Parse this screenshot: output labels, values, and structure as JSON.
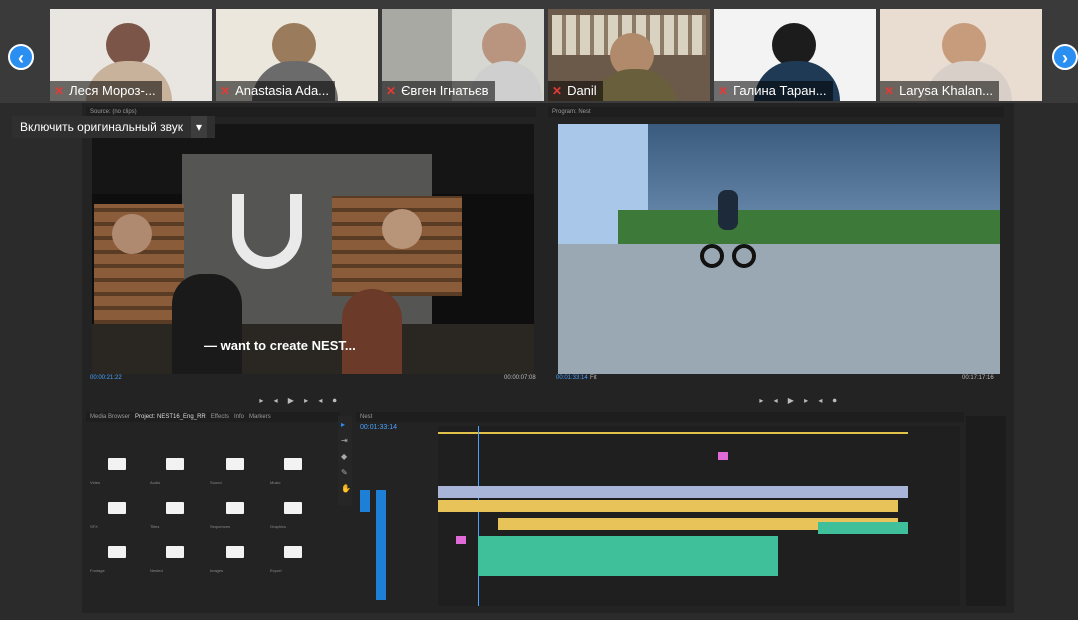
{
  "participants": [
    {
      "name": "Леся Мороз-..."
    },
    {
      "name": "Anastasia Ada..."
    },
    {
      "name": "Євген Ігнатьєв"
    },
    {
      "name": "Danil"
    },
    {
      "name": "Галина Таран..."
    },
    {
      "name": "Larysa Khalan..."
    }
  ],
  "nav": {
    "prev": "‹",
    "next": "›"
  },
  "sound_button": {
    "label": "Включить оригинальный звук",
    "caret": "▾"
  },
  "source_monitor": {
    "tab": "Source: (no clips)",
    "caption": "— want to create NEST...",
    "timecode_in": "00:00:21:22",
    "timecode_out": "00:00:07:08"
  },
  "program_monitor": {
    "tab": "Program: Nest",
    "timecode_in": "00:01:33:14",
    "fit": "Fit",
    "timecode_out": "00:17:17:16"
  },
  "project_panel": {
    "tabs": [
      "Media Browser",
      "Project: NEST16_Eng_RR",
      "Effects",
      "Info",
      "Markers"
    ],
    "items": [
      "Video",
      "Audio",
      "Sound",
      "Music",
      "SFX",
      "Titles",
      "Sequences",
      "Graphics",
      "Footage",
      "Nested",
      "Images",
      "Export"
    ]
  },
  "timeline": {
    "tab": "Nest",
    "timecode": "00:01:33:14"
  },
  "colors": {
    "accent": "#2a8ff0",
    "mic_muted": "#e53935",
    "clip_video": "#a8b4d8",
    "clip_yellow": "#e8c35a",
    "clip_audio": "#3fbf9a",
    "clip_pink": "#e06ad8"
  }
}
